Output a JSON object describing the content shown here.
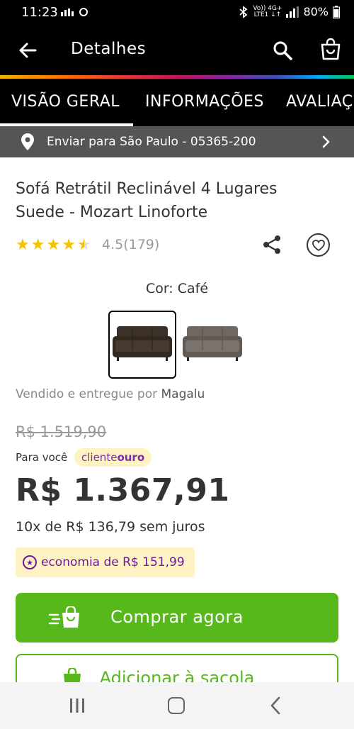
{
  "status_bar": {
    "time": "11:23",
    "battery": "80%",
    "network_label_top": "Vo)) 4G+",
    "network_label_bottom": "LTE1 ↓↑"
  },
  "app_bar": {
    "title": "Detalhes"
  },
  "tabs": [
    {
      "label": "VISÃO GERAL",
      "active": true
    },
    {
      "label": "INFORMAÇÕES",
      "active": false
    },
    {
      "label": "AVALIAÇ",
      "active": false
    }
  ],
  "shipping": {
    "text": "Enviar para São Paulo - 05365-200"
  },
  "product": {
    "title": "Sofá Retrátil Reclinável 4 Lugares Suede - Mozart Linoforte",
    "rating_value": 4.5,
    "rating_text": "4.5(179)",
    "color_label": "Cor: Café",
    "swatches": [
      {
        "name": "Café",
        "color": "#3b3129",
        "selected": true
      },
      {
        "name": "Cinza",
        "color": "#6f6761",
        "selected": false
      }
    ],
    "seller_prefix": "Vendido e entregue por",
    "seller_name": "Magalu"
  },
  "pricing": {
    "old_price": "R$ 1.519,90",
    "for_you_label": "Para você",
    "badge_cliente": "cliente",
    "badge_ouro": "ouro",
    "price": "R$ 1.367,91",
    "installments": "10x de R$ 136,79 sem juros",
    "economy": "economia de R$ 151,99"
  },
  "actions": {
    "buy_now": "Comprar agora",
    "add_to_bag": "Adicionar à sacola"
  },
  "colors": {
    "accent_green": "#56b81a",
    "economy_purple": "#6a1b9a",
    "badge_bg": "#fff3c4",
    "star": "#f5c100"
  }
}
